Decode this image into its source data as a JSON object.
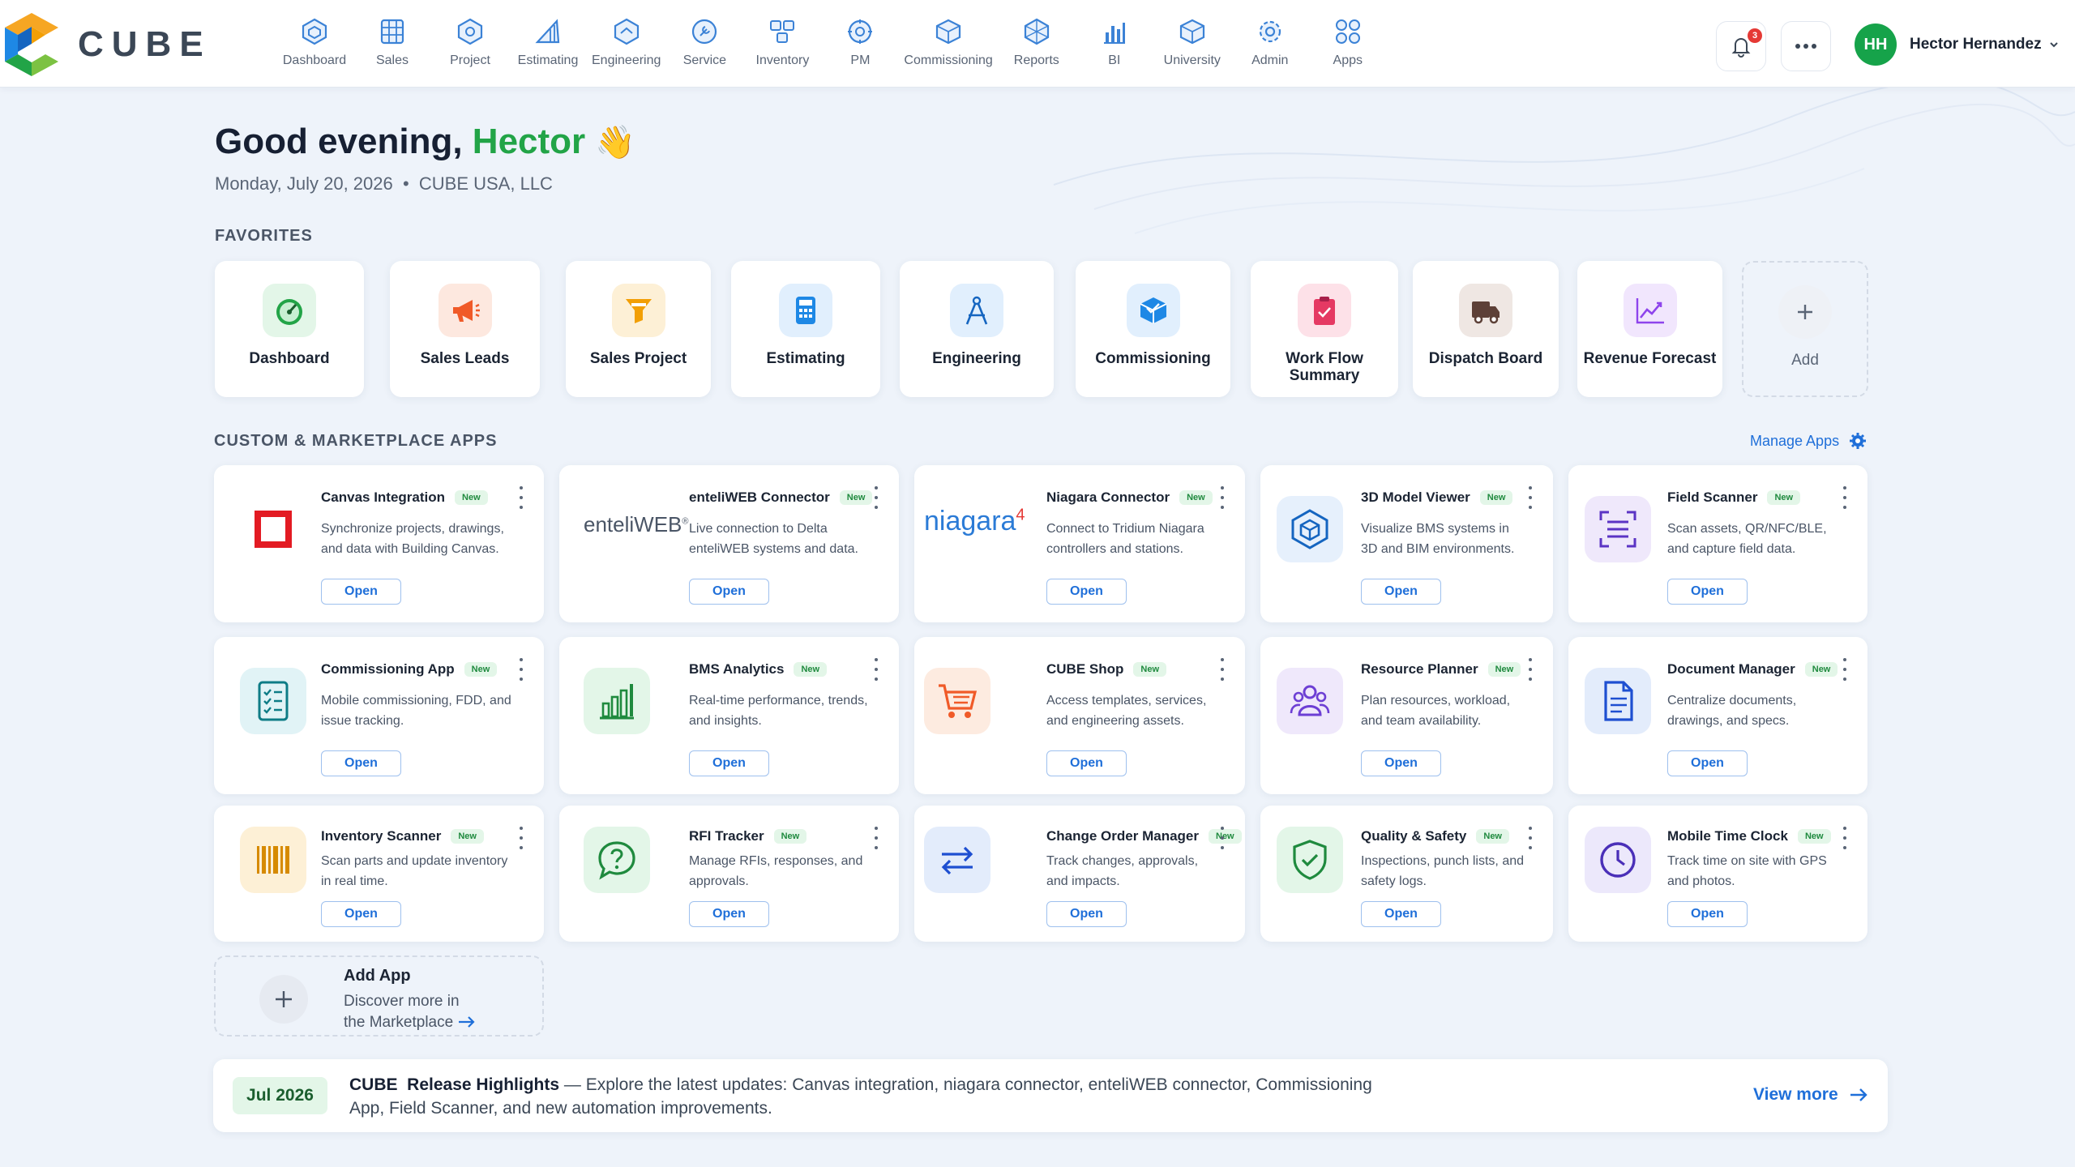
{
  "brand": {
    "name": "CUBE"
  },
  "nav": [
    {
      "label": "Dashboard",
      "icon": "dashboard-icon"
    },
    {
      "label": "Sales",
      "icon": "sales-icon"
    },
    {
      "label": "Project",
      "icon": "project-icon"
    },
    {
      "label": "Estimating",
      "icon": "estimating-icon"
    },
    {
      "label": "Engineering",
      "icon": "engineering-icon"
    },
    {
      "label": "Service",
      "icon": "service-icon"
    },
    {
      "label": "Inventory",
      "icon": "inventory-icon"
    },
    {
      "label": "PM",
      "icon": "pm-icon"
    },
    {
      "label": "Commissioning",
      "icon": "commissioning-icon"
    },
    {
      "label": "Reports",
      "icon": "reports-icon"
    },
    {
      "label": "BI",
      "icon": "bi-icon"
    },
    {
      "label": "University",
      "icon": "university-icon"
    },
    {
      "label": "Admin",
      "icon": "admin-icon"
    },
    {
      "label": "Apps",
      "icon": "apps-icon"
    }
  ],
  "header": {
    "notifications_count": "3",
    "user_initials": "HH",
    "user_name": "Hector Hernandez"
  },
  "greeting": {
    "prefix": "Good evening, ",
    "name": "Hector",
    "emoji": "👋",
    "date_line": "Monday, July 20, 2026  •  CUBE USA, LLC"
  },
  "favorites": {
    "label": "FAVORITES",
    "items": [
      {
        "label": "Dashboard",
        "icon": "gauge-icon",
        "color": "#22a447"
      },
      {
        "label": "Sales Leads",
        "icon": "megaphone-icon",
        "color": "#f05a28"
      },
      {
        "label": "Sales Project",
        "icon": "funnel-icon",
        "color": "#f29f05"
      },
      {
        "label": "Estimating",
        "icon": "calculator-icon",
        "color": "#1e88e5"
      },
      {
        "label": "Engineering",
        "icon": "compass-icon",
        "color": "#1565c0"
      },
      {
        "label": "Commissioning",
        "icon": "cube-check-icon",
        "color": "#1e88e5"
      },
      {
        "label": "Work Flow Summary",
        "icon": "clipboard-icon",
        "color": "#e53963"
      },
      {
        "label": "Dispatch Board",
        "icon": "truck-icon",
        "color": "#5d4037"
      },
      {
        "label": "Revenue Forecast",
        "icon": "trend-chart-icon",
        "color": "#8e44ec"
      }
    ],
    "add_label": "Add"
  },
  "apps": {
    "label": "CUSTOM & MARKETPLACE APPS",
    "manage_label": "Manage Apps",
    "badge": "New",
    "open_label": "Open",
    "items": [
      {
        "title": "Canvas Integration",
        "desc": "Synchronize projects, drawings, and data with Building Canvas.",
        "icon": "canvas-icon"
      },
      {
        "title": "enteliWEB Connector",
        "desc": "Live connection to Delta enteliWEB systems and data.",
        "icon": "enteliweb-logo",
        "wordmark": "enteliWEB"
      },
      {
        "title": "Niagara Connector",
        "desc": "Connect to Tridium Niagara controllers and stations.",
        "icon": "niagara-logo",
        "wordmark": "niagara"
      },
      {
        "title": "3D Model Viewer",
        "desc": "Visualize BMS systems in 3D and BIM environments.",
        "icon": "3d-cube-icon"
      },
      {
        "title": "Field Scanner",
        "desc": "Scan assets, QR/NFC/BLE, and capture field data.",
        "icon": "scanner-icon"
      },
      {
        "title": "Commissioning App",
        "desc": "Mobile commissioning, FDD, and issue tracking.",
        "icon": "checklist-icon"
      },
      {
        "title": "BMS Analytics",
        "desc": "Real-time performance, trends, and insights.",
        "icon": "bar-chart-icon"
      },
      {
        "title": "CUBE Shop",
        "desc": "Access templates, services, and engineering assets.",
        "icon": "cart-icon"
      },
      {
        "title": "Resource Planner",
        "desc": "Plan resources, workload, and team availability.",
        "icon": "team-icon"
      },
      {
        "title": "Document Manager",
        "desc": "Centralize documents, drawings, and specs.",
        "icon": "document-icon"
      },
      {
        "title": "Inventory Scanner",
        "desc": "Scan parts and update inventory in real time.",
        "icon": "barcode-icon"
      },
      {
        "title": "RFI Tracker",
        "desc": "Manage RFIs, responses, and approvals.",
        "icon": "question-bubble-icon"
      },
      {
        "title": "Change Order Manager",
        "desc": "Track changes, approvals, and impacts.",
        "icon": "swap-arrows-icon"
      },
      {
        "title": "Quality & Safety",
        "desc": "Inspections, punch lists, and safety logs.",
        "icon": "shield-check-icon"
      },
      {
        "title": "Mobile Time Clock",
        "desc": "Track time on site with GPS and photos.",
        "icon": "clock-icon"
      }
    ],
    "add_app": {
      "title": "Add App",
      "desc_line1": "Discover more in",
      "desc_line2": "the Marketplace"
    }
  },
  "release": {
    "badge": "Jul 2026",
    "title": "CUBE  Release Highlights",
    "text": " — Explore the latest updates: Canvas integration, niagara connector, enteliWEB connector, Commissioning App, Field Scanner, and new automation improvements.",
    "more_label": "View more"
  }
}
